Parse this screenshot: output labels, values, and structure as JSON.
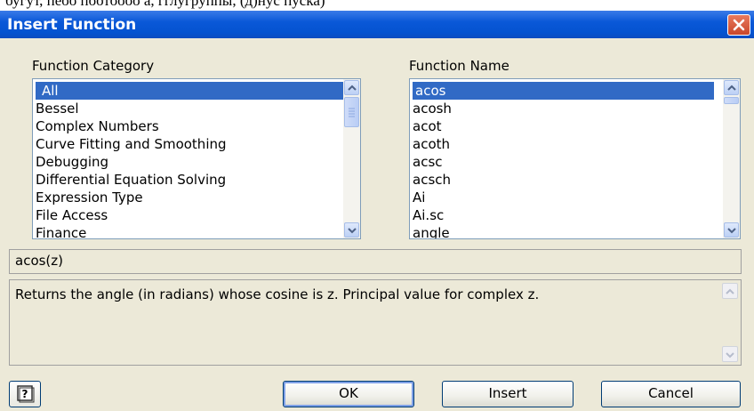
{
  "background_snippet": "бугут, пеоо поотоооо а, гглугруппы, (д)нус пуска)",
  "dialog": {
    "title": "Insert Function",
    "close_icon": "close-icon",
    "category_label": "Function Category",
    "name_label": "Function Name",
    "categories": [
      "All",
      "Bessel",
      "Complex Numbers",
      "Curve Fitting and Smoothing",
      "Debugging",
      "Differential Equation Solving",
      "Expression Type",
      "File Access",
      "Finance"
    ],
    "selected_category": "All",
    "functions": [
      "acos",
      "acosh",
      "acot",
      "acoth",
      "acsc",
      "acsch",
      "Ai",
      "Ai.sc",
      "angle"
    ],
    "selected_function": "acos",
    "syntax": "acos(z)",
    "description": "Returns the angle (in radians) whose cosine is z. Principal value for complex z.",
    "help_icon": "help-icon",
    "buttons": {
      "ok": "OK",
      "insert": "Insert",
      "cancel": "Cancel"
    },
    "colors": {
      "titlebar": "#0453d0",
      "selection": "#316ac5",
      "dialog_bg": "#ece9d8"
    }
  }
}
